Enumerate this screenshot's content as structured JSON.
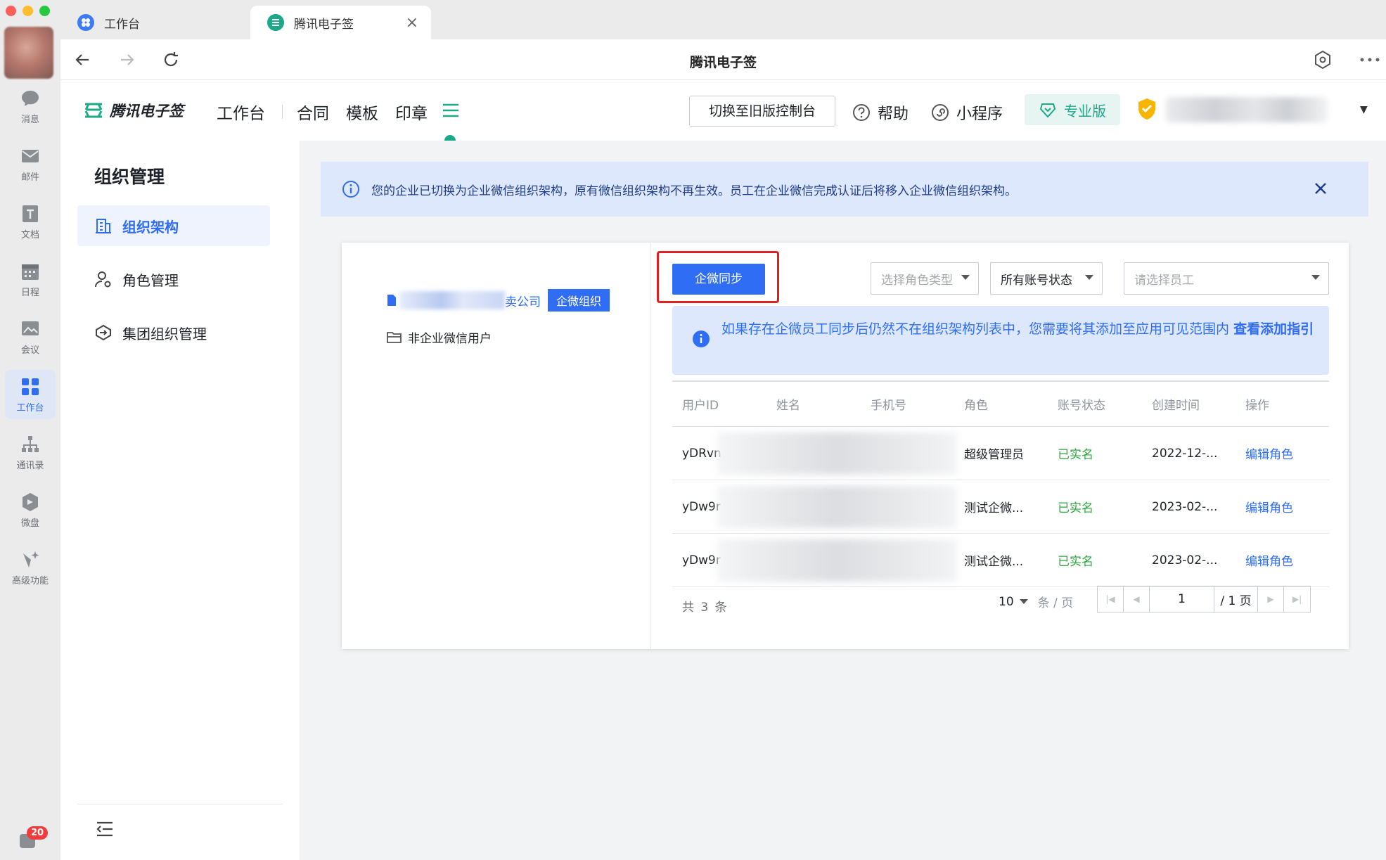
{
  "tabs": [
    {
      "label": "工作台",
      "active": false
    },
    {
      "label": "腾讯电子签",
      "active": true
    }
  ],
  "browser": {
    "title": "腾讯电子签"
  },
  "rail": {
    "items": [
      {
        "label": "消息",
        "icon": "chat-bubble-icon"
      },
      {
        "label": "邮件",
        "icon": "mail-icon"
      },
      {
        "label": "文档",
        "icon": "document-icon"
      },
      {
        "label": "日程",
        "icon": "calendar-icon"
      },
      {
        "label": "会议",
        "icon": "meeting-icon"
      },
      {
        "label": "工作台",
        "icon": "grid-icon",
        "active": true
      },
      {
        "label": "通讯录",
        "icon": "contacts-icon"
      },
      {
        "label": "微盘",
        "icon": "drive-icon"
      },
      {
        "label": "高级功能",
        "icon": "sparkle-icon"
      }
    ],
    "badge": "20"
  },
  "header": {
    "logo_text": "腾讯电子签",
    "nav": [
      "工作台",
      "合同",
      "模板",
      "印章"
    ],
    "switch_label": "切换至旧版控制台",
    "help_label": "帮助",
    "miniprogram_label": "小程序",
    "pro_label": "专业版"
  },
  "sidebar": {
    "title": "组织管理",
    "items": [
      {
        "label": "组织架构",
        "active": true
      },
      {
        "label": "角色管理",
        "active": false
      },
      {
        "label": "集团组织管理",
        "active": false
      }
    ]
  },
  "notice": {
    "text": "您的企业已切换为企业微信组织架构，原有微信组织架构不再生效。员工在企业微信完成认证后将移入企业微信组织架构。"
  },
  "tree": {
    "company_suffix": "卖公司",
    "company_tag": "企微组织",
    "non_wecom": "非企业微信用户"
  },
  "toolbar": {
    "sync_label": "企微同步",
    "role_type_placeholder": "选择角色类型",
    "account_status": "所有账号状态",
    "employee_placeholder": "请选择员工"
  },
  "tip": {
    "text": "如果存在企微员工同步后仍然不在组织架构列表中，您需要将其添加至应用可见范围内",
    "link_text": "查看添加指引"
  },
  "table": {
    "headers": [
      "用户ID",
      "姓名",
      "手机号",
      "角色",
      "账号状态",
      "创建时间",
      "操作"
    ],
    "rows": [
      {
        "user_id": "yDRvn",
        "role": "超级管理员",
        "status": "已实名",
        "created": "2022-12-...",
        "action": "编辑角色"
      },
      {
        "user_id": "yDw9r",
        "role": "测试企微...",
        "status": "已实名",
        "created": "2023-02-...",
        "action": "编辑角色"
      },
      {
        "user_id": "yDw9r",
        "role": "测试企微...",
        "status": "已实名",
        "created": "2023-02-...",
        "action": "编辑角色"
      }
    ]
  },
  "pagination": {
    "total": "共 3 条",
    "page_size": "10",
    "unit": "条 / 页",
    "current": "1",
    "pages": "/ 1 页"
  },
  "colors": {
    "primary": "#2f6df5",
    "brand_green": "#1ba98a",
    "success": "#2ba83c",
    "highlight": "#e02020"
  }
}
